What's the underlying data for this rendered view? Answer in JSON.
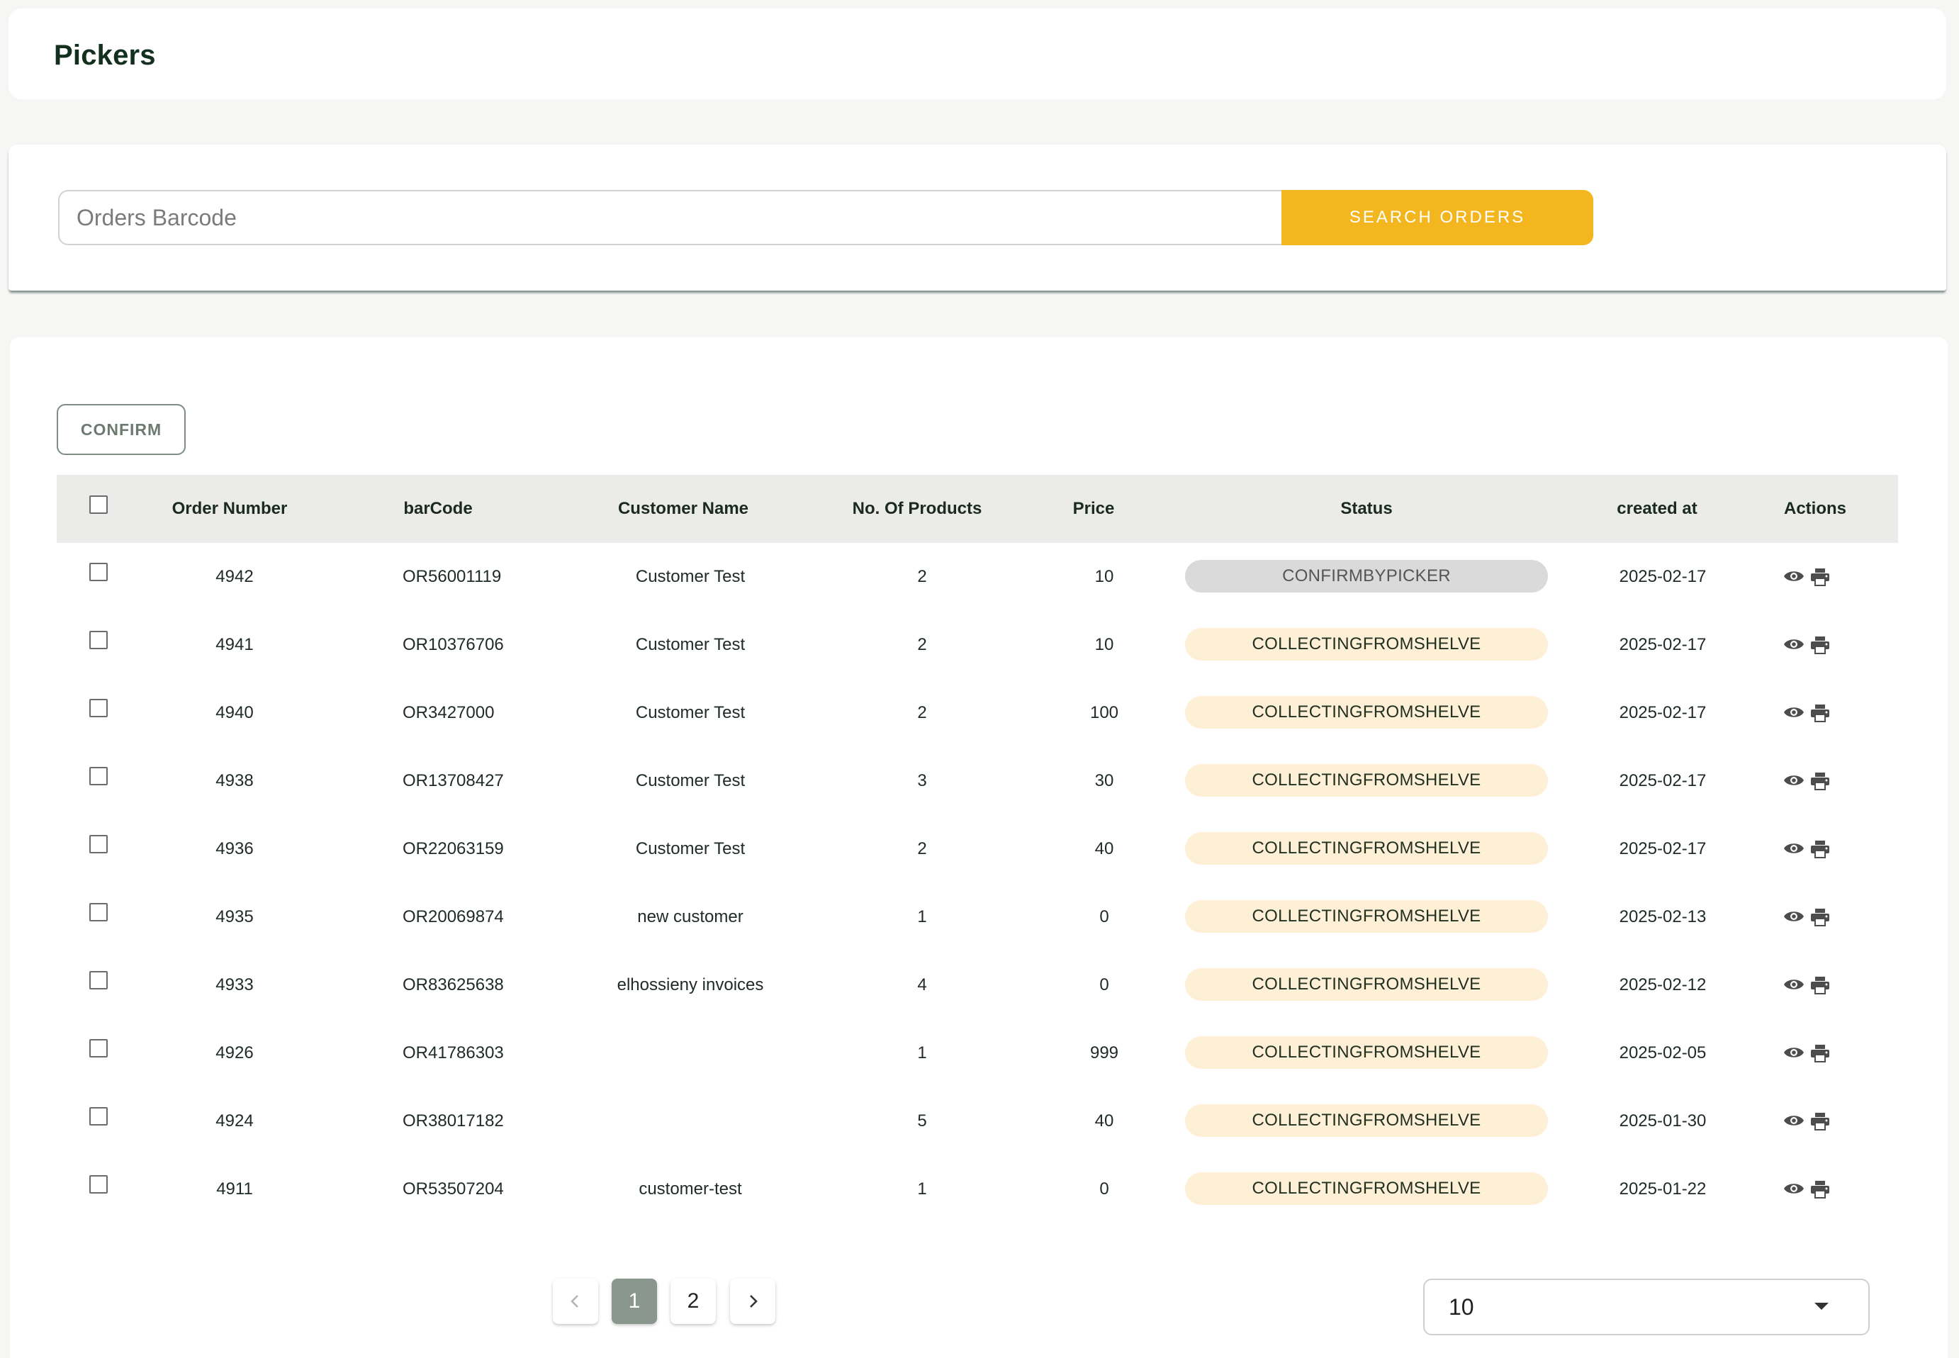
{
  "page": {
    "title": "Pickers"
  },
  "search": {
    "placeholder": "Orders Barcode",
    "button_label": "SEARCH ORDERS"
  },
  "toolbar": {
    "confirm_label": "CONFIRM"
  },
  "table": {
    "columns": [
      "Order Number",
      "barCode",
      "Customer Name",
      "No. Of Products",
      "Price",
      "Status",
      "created at",
      "Actions"
    ],
    "rows": [
      {
        "order_number": "4942",
        "barcode": "OR56001119",
        "customer": "Customer Test",
        "products": "2",
        "price": "10",
        "status": "CONFIRMBYPICKER",
        "created_at": "2025-02-17"
      },
      {
        "order_number": "4941",
        "barcode": "OR10376706",
        "customer": "Customer Test",
        "products": "2",
        "price": "10",
        "status": "COLLECTINGFROMSHELVE",
        "created_at": "2025-02-17"
      },
      {
        "order_number": "4940",
        "barcode": "OR3427000",
        "customer": "Customer Test",
        "products": "2",
        "price": "100",
        "status": "COLLECTINGFROMSHELVE",
        "created_at": "2025-02-17"
      },
      {
        "order_number": "4938",
        "barcode": "OR13708427",
        "customer": "Customer Test",
        "products": "3",
        "price": "30",
        "status": "COLLECTINGFROMSHELVE",
        "created_at": "2025-02-17"
      },
      {
        "order_number": "4936",
        "barcode": "OR22063159",
        "customer": "Customer Test",
        "products": "2",
        "price": "40",
        "status": "COLLECTINGFROMSHELVE",
        "created_at": "2025-02-17"
      },
      {
        "order_number": "4935",
        "barcode": "OR20069874",
        "customer": "new customer",
        "products": "1",
        "price": "0",
        "status": "COLLECTINGFROMSHELVE",
        "created_at": "2025-02-13"
      },
      {
        "order_number": "4933",
        "barcode": "OR83625638",
        "customer": "elhossieny invoices",
        "products": "4",
        "price": "0",
        "status": "COLLECTINGFROMSHELVE",
        "created_at": "2025-02-12"
      },
      {
        "order_number": "4926",
        "barcode": "OR41786303",
        "customer": "",
        "products": "1",
        "price": "999",
        "status": "COLLECTINGFROMSHELVE",
        "created_at": "2025-02-05"
      },
      {
        "order_number": "4924",
        "barcode": "OR38017182",
        "customer": "",
        "products": "5",
        "price": "40",
        "status": "COLLECTINGFROMSHELVE",
        "created_at": "2025-01-30"
      },
      {
        "order_number": "4911",
        "barcode": "OR53507204",
        "customer": "customer-test",
        "products": "1",
        "price": "0",
        "status": "COLLECTINGFROMSHELVE",
        "created_at": "2025-01-22"
      }
    ]
  },
  "pagination": {
    "pages": [
      "1",
      "2"
    ],
    "current": "1"
  },
  "page_size": {
    "value": "10"
  },
  "colors": {
    "accent": "#f4b61f",
    "status_confirmed": "#dadada",
    "status_collecting": "#fdf0d7",
    "active_page": "#8a978e"
  }
}
